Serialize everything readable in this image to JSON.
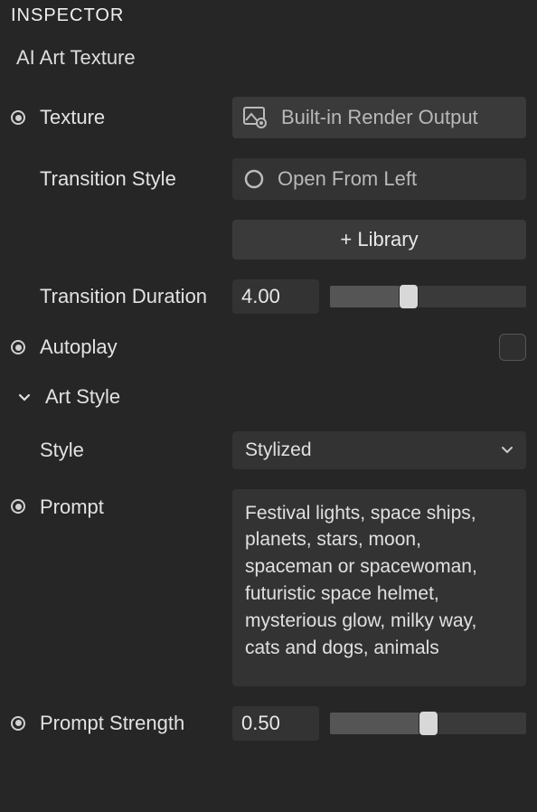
{
  "panel": {
    "title": "INSPECTOR",
    "subtitle": "AI Art Texture"
  },
  "texture": {
    "label": "Texture",
    "value": "Built-in Render Output"
  },
  "transition_style": {
    "label": "Transition Style",
    "value": "Open From Left"
  },
  "library_button": "+ Library",
  "transition_duration": {
    "label": "Transition Duration",
    "value": "4.00",
    "slider_pct": 40
  },
  "autoplay": {
    "label": "Autoplay",
    "checked": false
  },
  "art_style_section": "Art Style",
  "style": {
    "label": "Style",
    "value": "Stylized"
  },
  "prompt": {
    "label": "Prompt",
    "value": "Festival lights, space ships, planets, stars, moon, spaceman or spacewoman, futuristic space helmet, mysterious glow, milky way, cats and dogs, animals"
  },
  "prompt_strength": {
    "label": "Prompt Strength",
    "value": "0.50",
    "slider_pct": 50
  }
}
